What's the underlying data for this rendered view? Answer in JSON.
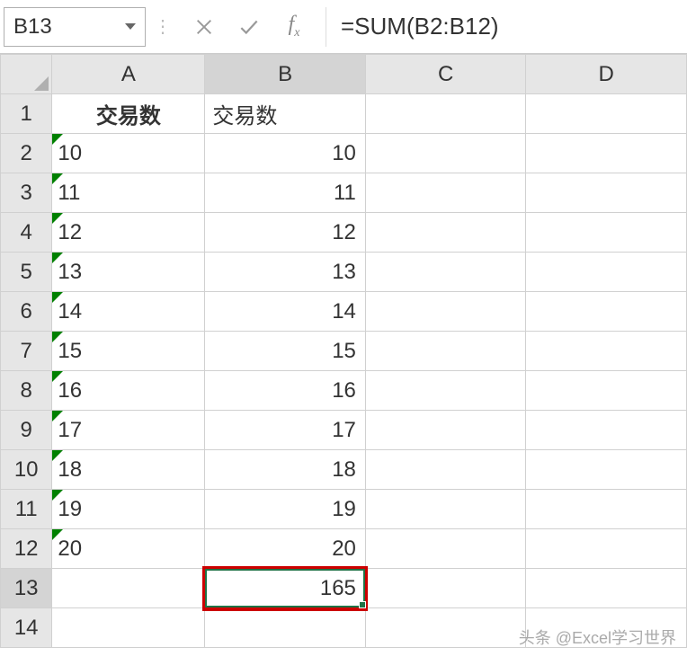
{
  "name_box": {
    "value": "B13"
  },
  "formula_bar": {
    "value": "=SUM(B2:B12)"
  },
  "columns": [
    "A",
    "B",
    "C",
    "D"
  ],
  "row_numbers": [
    "1",
    "2",
    "3",
    "4",
    "5",
    "6",
    "7",
    "8",
    "9",
    "10",
    "11",
    "12",
    "13",
    "14"
  ],
  "headers": {
    "A": "交易数",
    "B": "交易数"
  },
  "data": {
    "A": [
      "10",
      "11",
      "12",
      "13",
      "14",
      "15",
      "16",
      "17",
      "18",
      "19",
      "20"
    ],
    "B": [
      "10",
      "11",
      "12",
      "13",
      "14",
      "15",
      "16",
      "17",
      "18",
      "19",
      "20"
    ]
  },
  "result_cell": {
    "value": "165"
  },
  "watermark": "头条 @Excel学习世界",
  "chart_data": {
    "type": "table",
    "title": "",
    "columns": [
      "交易数 (A, text)",
      "交易数 (B, number)"
    ],
    "rows": [
      [
        "10",
        10
      ],
      [
        "11",
        11
      ],
      [
        "12",
        12
      ],
      [
        "13",
        13
      ],
      [
        "14",
        14
      ],
      [
        "15",
        15
      ],
      [
        "16",
        16
      ],
      [
        "17",
        17
      ],
      [
        "18",
        18
      ],
      [
        "19",
        19
      ],
      [
        "20",
        20
      ]
    ],
    "sum_B": 165,
    "formula": "=SUM(B2:B12)",
    "active_cell": "B13"
  }
}
